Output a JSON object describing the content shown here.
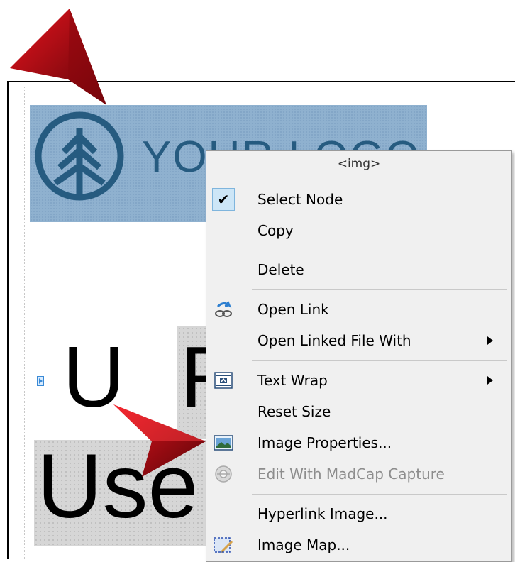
{
  "editor": {
    "logo_text": "YOUR LOGO",
    "heading_fragments": [
      "U",
      "F",
      "Use"
    ]
  },
  "context_menu": {
    "header": "<img>",
    "items": [
      {
        "label": "Select Node",
        "icon": "check-icon",
        "checked": true
      },
      {
        "label": "Copy",
        "icon": null
      },
      {
        "label": "Delete",
        "icon": null
      },
      {
        "label": "Open Link",
        "icon": "open-link-icon"
      },
      {
        "label": "Open Linked File With",
        "icon": null,
        "submenu": true
      },
      {
        "label": "Text Wrap",
        "icon": "text-wrap-icon",
        "submenu": true
      },
      {
        "label": "Reset Size",
        "icon": null
      },
      {
        "label": "Image Properties...",
        "icon": "image-properties-icon"
      },
      {
        "label": "Edit With MadCap Capture",
        "icon": "madcap-capture-icon",
        "disabled": true
      },
      {
        "label": "Hyperlink Image...",
        "icon": null
      },
      {
        "label": "Image Map...",
        "icon": "image-map-icon"
      }
    ]
  },
  "colors": {
    "logo_background": "#8fb1cf",
    "logo_foreground": "#265b80",
    "menu_background": "#f0f0f0",
    "arrow_red": "#c8101a"
  }
}
